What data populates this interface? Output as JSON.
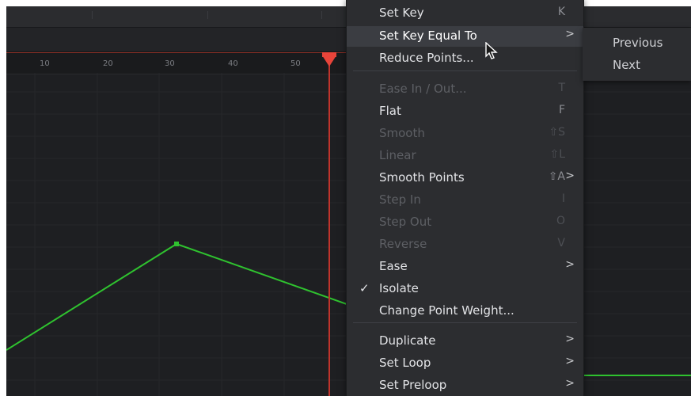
{
  "ruler": {
    "ticks": [
      "10",
      "20",
      "30",
      "40",
      "50"
    ]
  },
  "menu": {
    "items": [
      {
        "label": "Set Key",
        "shortcut": "K",
        "enabled": true
      },
      {
        "label": "Set Key Equal To",
        "submenu": true,
        "enabled": true,
        "highlighted": true
      },
      {
        "label": "Reduce Points...",
        "enabled": true
      },
      {
        "label": "Ease In / Out...",
        "shortcut": "T",
        "enabled": false
      },
      {
        "label": "Flat",
        "shortcut": "F",
        "enabled": true
      },
      {
        "label": "Smooth",
        "shortcut": "⇧S",
        "enabled": false
      },
      {
        "label": "Linear",
        "shortcut": "⇧L",
        "enabled": false
      },
      {
        "label": "Smooth Points",
        "shortcut": "⇧A",
        "submenu": true,
        "enabled": true
      },
      {
        "label": "Step In",
        "shortcut": "I",
        "enabled": false
      },
      {
        "label": "Step Out",
        "shortcut": "O",
        "enabled": false
      },
      {
        "label": "Reverse",
        "shortcut": "V",
        "enabled": false
      },
      {
        "label": "Ease",
        "submenu": true,
        "enabled": true
      },
      {
        "label": "Isolate",
        "checked": true,
        "enabled": true
      },
      {
        "label": "Change Point Weight...",
        "enabled": true
      },
      {
        "label": "Duplicate",
        "submenu": true,
        "enabled": true
      },
      {
        "label": "Set Loop",
        "submenu": true,
        "enabled": true
      },
      {
        "label": "Set Preloop",
        "submenu": true,
        "enabled": true
      }
    ],
    "arrow_glyph": ">",
    "check_glyph": "✓"
  },
  "submenu": {
    "items": [
      "Previous",
      "Next"
    ]
  },
  "colors": {
    "curve": "#2fc22f",
    "playhead": "#e8443a",
    "menu_bg": "#2c2d30"
  }
}
